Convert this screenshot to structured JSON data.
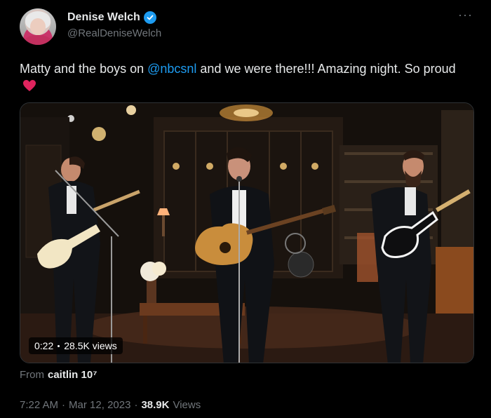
{
  "author": {
    "display_name": "Denise Welch",
    "handle": "@RealDeniseWelch",
    "avatar_icon": "profile-photo",
    "verified_icon": "verified-badge-icon"
  },
  "tweet": {
    "text_before": "Matty and the boys on ",
    "mention": "@nbcsnl",
    "text_after": " and we were there!!! Amazing night. So proud",
    "emoji": "red-heart"
  },
  "video": {
    "elapsed": "0:22",
    "views": "28.5K views"
  },
  "from": {
    "label": "From",
    "user": "caitlin 10⁷"
  },
  "meta": {
    "time": "7:22 AM",
    "date": "Mar 12, 2023",
    "views_count": "38.9K",
    "views_label": "Views",
    "separator": "·"
  },
  "colors": {
    "accent": "#1d9bf0",
    "background": "#000000",
    "secondary_text": "#71767b",
    "heart": "#f91880"
  }
}
